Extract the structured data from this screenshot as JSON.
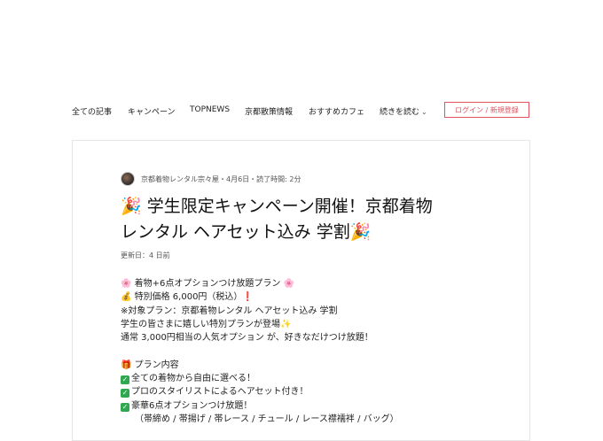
{
  "nav": {
    "items": [
      "全ての記事",
      "キャンペーン",
      "TOPNEWS",
      "京都散策情報",
      "おすすめカフェ",
      "続きを読む"
    ],
    "login_label": "ログイン / 新規登録"
  },
  "post": {
    "author_line": "京都着物レンタル宗々屋・4月6日・読了時間: 2分",
    "more_glyph": "⋮",
    "title_line1": "🎉 学生限定キャンペーン開催！京都着物",
    "title_line2": "レンタル ヘアセット込み 学割🎉",
    "updated": "更新日：4 日前",
    "lines": {
      "l1": "🌸 着物+6点オプションつけ放題プラン 🌸",
      "l2": "💰 特別価格 6,000円（税込）❗",
      "l3": "※対象プラン：京都着物レンタル ヘアセット込み 学割",
      "l4": "学生の皆さまに嬉しい特別プランが登場✨",
      "l5": "通常 3,000円相当の人気オプション が、好きなだけつけ放題！",
      "l6": "🎁 プラン内容",
      "l7": "全ての着物から自由に選べる！",
      "l8": "プロのスタイリストによるヘアセット付き！",
      "l9": "豪華6点オプションつけ放題！",
      "l10": "（帯締め / 帯揚げ / 帯レース / チュール / レース襟襦袢 / バッグ）"
    },
    "check_glyph": "✓"
  }
}
